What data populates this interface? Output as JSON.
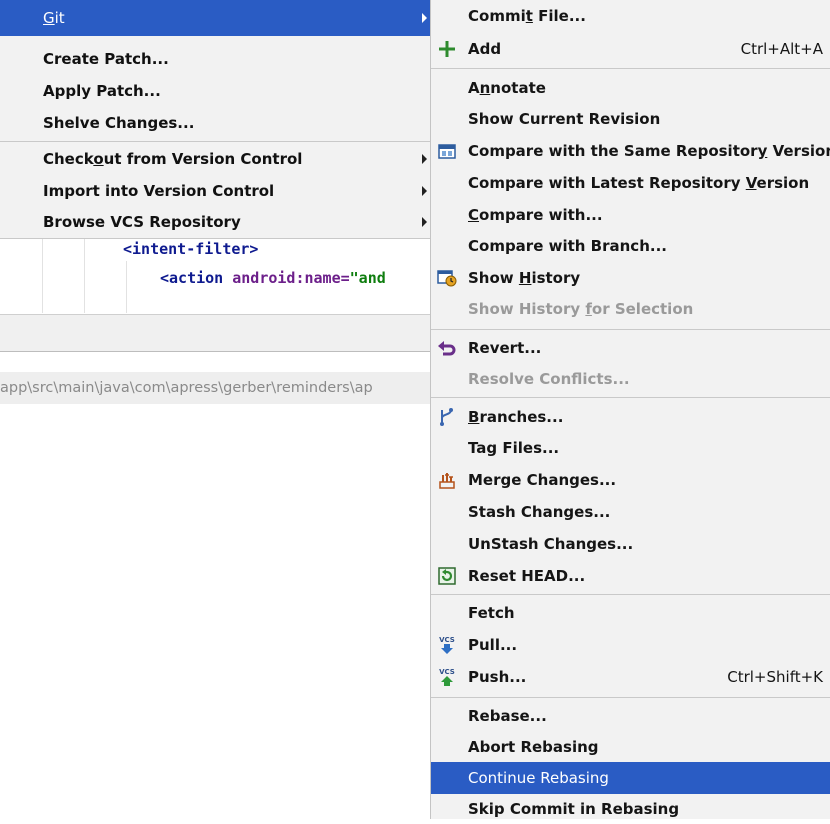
{
  "vcs_menu": {
    "items": [
      {
        "pre": "",
        "u": "G",
        "post": "it",
        "has_submenu": true,
        "highlighted": true
      },
      {
        "pre": "Create Patch...",
        "u": "",
        "post": "",
        "has_submenu": false
      },
      {
        "pre": "Apply Patch...",
        "u": "",
        "post": "",
        "has_submenu": false
      },
      {
        "pre": "Shelve Changes...",
        "u": "",
        "post": "",
        "has_submenu": false
      },
      {
        "pre": "Check",
        "u": "o",
        "post": "ut from Version Control",
        "has_submenu": true
      },
      {
        "pre": "Import into Version Control",
        "u": "",
        "post": "",
        "has_submenu": true
      },
      {
        "pre": "Browse VCS Repository",
        "u": "",
        "post": "",
        "has_submenu": true
      }
    ]
  },
  "editor": {
    "line1": "<intent-filter>",
    "line2_tag": "<action ",
    "line2_attr": "android:name=",
    "line2_str": "\"and"
  },
  "status_bar": {
    "path": "app\\src\\main\\java\\com\\apress\\gerber\\reminders\\ap"
  },
  "git_menu": {
    "items": [
      {
        "pre": "Commi",
        "u": "t",
        "post": " File...",
        "icon": ""
      },
      {
        "pre": "Add",
        "u": "",
        "post": "",
        "icon": "plus-icon",
        "shortcut": "Ctrl+Alt+A"
      },
      {
        "pre": "A",
        "u": "n",
        "post": "notate",
        "icon": ""
      },
      {
        "pre": "Show Current Revision",
        "u": "",
        "post": "",
        "icon": ""
      },
      {
        "pre": "Compare with the Same Repositor",
        "u": "y",
        "post": " Version",
        "icon": "compare-icon"
      },
      {
        "pre": "Compare with Latest Repository ",
        "u": "V",
        "post": "ersion",
        "icon": ""
      },
      {
        "pre": "",
        "u": "C",
        "post": "ompare with...",
        "icon": ""
      },
      {
        "pre": "Compare with Branch...",
        "u": "",
        "post": "",
        "icon": ""
      },
      {
        "pre": "Show ",
        "u": "H",
        "post": "istory",
        "icon": "history-icon"
      },
      {
        "pre": "Show History ",
        "u": "f",
        "post": "or Selection",
        "icon": "",
        "disabled": true
      },
      {
        "pre": "Revert...",
        "u": "",
        "post": "",
        "icon": "revert-icon"
      },
      {
        "pre": "Resolve Conflicts...",
        "u": "",
        "post": "",
        "icon": "",
        "disabled": true
      },
      {
        "pre": "",
        "u": "B",
        "post": "ranches...",
        "icon": "branches-icon"
      },
      {
        "pre": "Tag Files...",
        "u": "",
        "post": "",
        "icon": ""
      },
      {
        "pre": "Merge Changes...",
        "u": "",
        "post": "",
        "icon": "merge-icon"
      },
      {
        "pre": "Stash Changes...",
        "u": "",
        "post": "",
        "icon": ""
      },
      {
        "pre": "UnStash Changes...",
        "u": "",
        "post": "",
        "icon": ""
      },
      {
        "pre": "Reset HEAD...",
        "u": "",
        "post": "",
        "icon": "reset-icon"
      },
      {
        "pre": "Fetch",
        "u": "",
        "post": "",
        "icon": ""
      },
      {
        "pre": "Pull...",
        "u": "",
        "post": "",
        "icon": "vcs-pull-icon"
      },
      {
        "pre": "Push...",
        "u": "",
        "post": "",
        "icon": "vcs-push-icon",
        "shortcut": "Ctrl+Shift+K"
      },
      {
        "pre": "Rebase...",
        "u": "",
        "post": "",
        "icon": ""
      },
      {
        "pre": "Abort Rebasing",
        "u": "",
        "post": "",
        "icon": ""
      },
      {
        "pre": "Continue Rebasing",
        "u": "",
        "post": "",
        "icon": "",
        "highlighted": true
      },
      {
        "pre": "Skip Commit in Rebasing",
        "u": "",
        "post": "",
        "icon": ""
      }
    ],
    "icon_text": {
      "vcs": "VCS"
    }
  },
  "colors": {
    "highlight": "#2a5cc4",
    "menu_bg": "#f2f2f2",
    "disabled_text": "#9a9a9a"
  }
}
